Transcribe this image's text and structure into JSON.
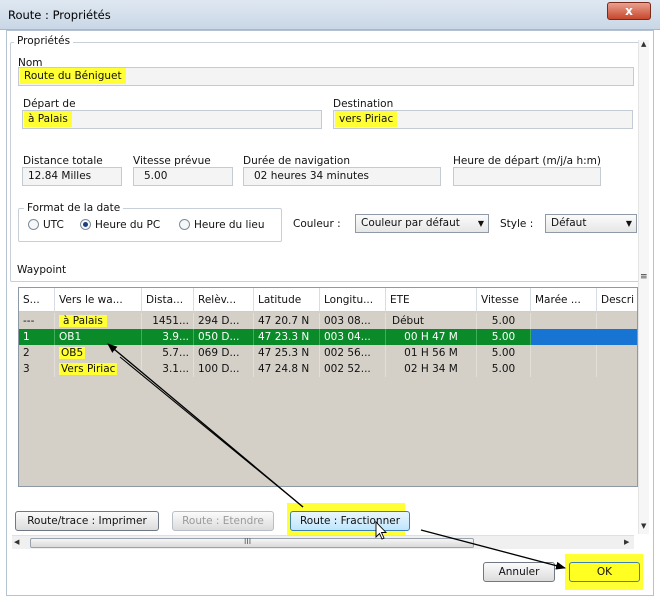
{
  "window": {
    "title": "Route : Propriétés",
    "close_glyph": "x"
  },
  "props": {
    "group_label": "Propriétés",
    "nom_label": "Nom",
    "nom_value": "Route du Béniguet",
    "depart_label": "Départ de",
    "depart_value": "à Palais",
    "destination_label": "Destination",
    "destination_value": "vers Piriac",
    "distance_label": "Distance totale",
    "distance_value": "12.84 Milles",
    "vitesse_label": "Vitesse prévue",
    "vitesse_value": "5.00",
    "duree_label": "Durée de navigation",
    "duree_value": "02 heures  34 minutes",
    "heure_depart_label": "Heure de départ (m/j/a h:m)",
    "heure_depart_value": "",
    "format_label": "Format de la date",
    "format_options": [
      "UTC",
      "Heure du PC",
      "Heure du lieu"
    ],
    "format_selected": "Heure du PC",
    "couleur_label": "Couleur :",
    "couleur_value": "Couleur par défaut",
    "style_label": "Style :",
    "style_value": "Défaut"
  },
  "waypoints": {
    "label": "Waypoint",
    "headers": [
      "S...",
      "Vers le wa...",
      "Dista...",
      "Relèv...",
      "Latitude",
      "Longitu...",
      "ETE",
      "Vitesse",
      "Marée ...",
      "Descri"
    ],
    "rows": [
      [
        "---",
        "à Palais",
        "1451...",
        "294 D...",
        "47 20.7 N",
        "003 08...",
        "Début",
        "5.00",
        "",
        ""
      ],
      [
        "1",
        "OB1",
        "3.9...",
        "050 D...",
        "47 23.3 N",
        "003 04...",
        "00 H  47 M",
        "5.00",
        "",
        ""
      ],
      [
        "2",
        "OB5",
        "5.7...",
        "069 D...",
        "47 25.3 N",
        "002 56...",
        "01 H  56 M",
        "5.00",
        "",
        ""
      ],
      [
        "3",
        "Vers Piriac",
        "3.1...",
        "100 D...",
        "47 24.8 N",
        "002 52...",
        "02 H  34 M",
        "5.00",
        "",
        ""
      ]
    ],
    "selected_row": 1
  },
  "buttons": {
    "imprimer": "Route/trace : Imprimer",
    "etendre": "Route : Etendre",
    "fractionner": "Route : Fractionner",
    "annuler": "Annuler",
    "ok": "OK"
  },
  "scroll": {
    "grip": "III"
  },
  "colors": {
    "highlight": "#ffff33",
    "selection": "#0b8a2a",
    "accent_blue": "#1874d2"
  }
}
